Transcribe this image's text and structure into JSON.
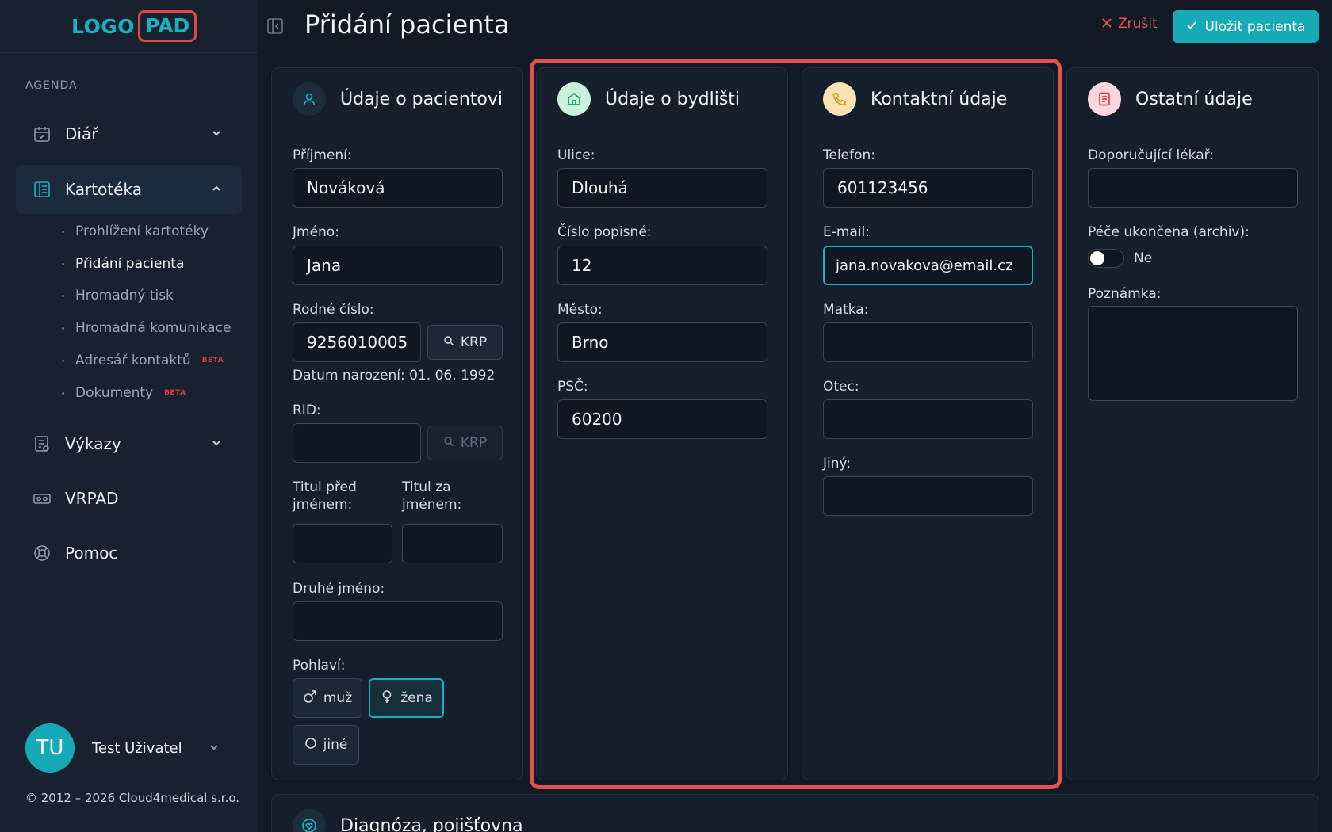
{
  "logo": {
    "part1": "LOGO",
    "part2": "PAD"
  },
  "sidebar": {
    "section_label": "AGENDA",
    "items": [
      {
        "label": "Diář",
        "icon": "calendar-icon"
      },
      {
        "label": "Kartotéka",
        "icon": "book-icon"
      },
      {
        "label": "Výkazy",
        "icon": "report-icon"
      },
      {
        "label": "VRPAD",
        "icon": "vr-icon"
      },
      {
        "label": "Pomoc",
        "icon": "lifebuoy-icon"
      }
    ],
    "subitems": [
      {
        "label": "Prohlížení kartotéky"
      },
      {
        "label": "Přidání pacienta"
      },
      {
        "label": "Hromadný tisk"
      },
      {
        "label": "Hromadná komunikace"
      },
      {
        "label": "Adresář kontaktů",
        "badge": "BETA"
      },
      {
        "label": "Dokumenty",
        "badge": "BETA"
      }
    ],
    "user": {
      "initials": "TU",
      "name": "Test Uživatel"
    },
    "copyright": "© 2012 – 2026 Cloud4medical s.r.o."
  },
  "header": {
    "title": "Přidání pacienta",
    "cancel_label": "Zrušit",
    "save_label": "Uložit pacienta"
  },
  "patient": {
    "title": "Údaje o pacientovi",
    "surname_label": "Příjmení:",
    "surname": "Nováková",
    "name_label": "Jméno:",
    "name": "Jana",
    "birth_number_label": "Rodné číslo:",
    "birth_number": "9256010005",
    "krp_label": "KRP",
    "birth_date_text": "Datum narození: 01. 06. 1992",
    "rid_label": "RID:",
    "rid": "",
    "title_before_label_1": "Titul před",
    "title_before_label_2": "jménem:",
    "title_after_label_1": "Titul za",
    "title_after_label_2": "jménem:",
    "second_name_label": "Druhé jméno:",
    "sex_label": "Pohlaví:",
    "sex_male": "muž",
    "sex_female": "žena",
    "sex_other": "jiné",
    "sex_selected": "žena"
  },
  "residence": {
    "title": "Údaje o bydlišti",
    "street_label": "Ulice:",
    "street": "Dlouhá",
    "number_label": "Číslo popisné:",
    "number": "12",
    "city_label": "Město:",
    "city": "Brno",
    "zip_label": "PSČ:",
    "zip": "60200"
  },
  "contact": {
    "title": "Kontaktní údaje",
    "phone_label": "Telefon:",
    "phone": "601123456",
    "email_label": "E-mail:",
    "email": "jana.novakova@email.cz",
    "mother_label": "Matka:",
    "father_label": "Otec:",
    "other_label": "Jiný:"
  },
  "other": {
    "title": "Ostatní údaje",
    "referring_label": "Doporučující lékař:",
    "archive_label": "Péče ukončena (archiv):",
    "archive_value": "Ne",
    "note_label": "Poznámka:"
  },
  "bottom": {
    "title": "Diagnóza, pojišťovna"
  },
  "colors": {
    "accent": "#16aab6",
    "danger": "#e04848",
    "background": "#111a25"
  }
}
